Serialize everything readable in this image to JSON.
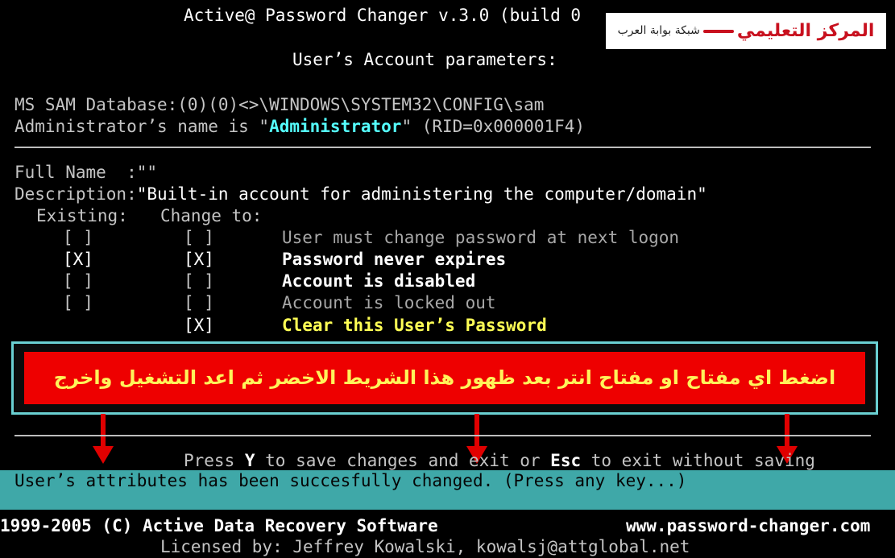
{
  "header": {
    "title": "Active@ Password Changer v.3.0 (build 0",
    "subtitle": "User’s Account parameters:"
  },
  "sam": {
    "line": "MS SAM Database:(0)(0)<>\\WINDOWS\\SYSTEM32\\CONFIG\\sam",
    "admin_prefix": "Administrator’s name is \"",
    "admin_name": "Administrator",
    "admin_suffix": "\" (RID=0x000001F4)"
  },
  "account": {
    "full_name_label": "Full Name  :",
    "full_name_value": "\"\"",
    "description_label": "Description:",
    "description_value": "\"Built-in account for administering the computer/domain\"",
    "existing_label": "Existing:",
    "change_label": "Change to:"
  },
  "options": [
    {
      "existing": "[ ]",
      "change": "[ ]",
      "label": "User must change password at next logon"
    },
    {
      "existing": "[X]",
      "change": "[X]",
      "label": "Password never expires"
    },
    {
      "existing": "[ ]",
      "change": "[ ]",
      "label": "Account is disabled"
    },
    {
      "existing": "[ ]",
      "change": "[ ]",
      "label": "Account is locked out"
    },
    {
      "existing": "",
      "change": "[X]",
      "label": "Clear this User’s Password"
    }
  ],
  "banner": {
    "text": "اضغط اي مفتاح او مفتاح انتر بعد ظهور هذا الشريط الاخضر ثم اعد التشغيل واخرج"
  },
  "logo": {
    "main": "المركز التعليمي",
    "sub": "شبكة بوابة العرب"
  },
  "prompt": {
    "before_y": "Press ",
    "key_y": "Y",
    "mid": " to save changes and exit or ",
    "key_esc": "Esc",
    "after": " to exit without saving"
  },
  "status": {
    "message": "User’s attributes has been succesfully changed. (Press any key...)"
  },
  "footer": {
    "copyright": "1999-2005 (C) Active Data Recovery Software",
    "website": "www.password-changer.com",
    "license": "Licensed by: Jeffrey Kowalski, kowalsj@attglobal.net"
  },
  "colors": {
    "background": "#000000",
    "text": "#c4c4c4",
    "highlight_cyan": "#55ffff",
    "highlight_yellow": "#ffff55",
    "status_bar": "#3fa8a8",
    "banner_red": "#ee0000",
    "banner_border": "#6ad0d2",
    "arrow_red": "#e00000"
  },
  "icons": [
    "down-arrow-icon",
    "down-arrow-icon",
    "down-arrow-icon"
  ]
}
